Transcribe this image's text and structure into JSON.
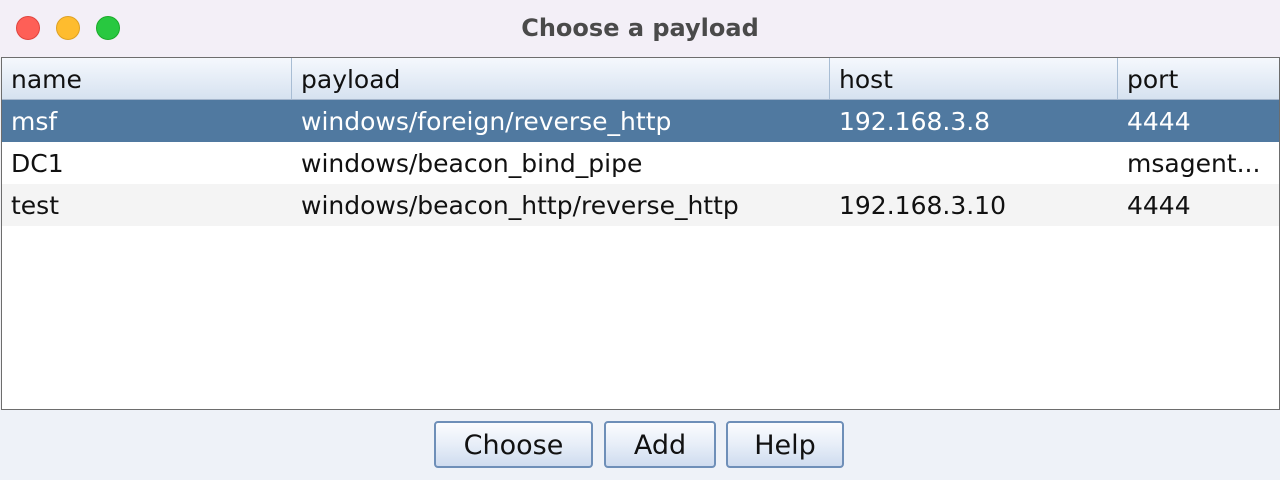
{
  "window": {
    "title": "Choose a payload"
  },
  "table": {
    "columns": [
      "name",
      "payload",
      "host",
      "port"
    ],
    "rows": [
      {
        "name": "msf",
        "payload": "windows/foreign/reverse_http",
        "host": "192.168.3.8",
        "port": "4444",
        "selected": true
      },
      {
        "name": "DC1",
        "payload": "windows/beacon_bind_pipe",
        "host": "",
        "port": "msagent...",
        "selected": false
      },
      {
        "name": "test",
        "payload": "windows/beacon_http/reverse_http",
        "host": "192.168.3.10",
        "port": "4444",
        "selected": false
      }
    ]
  },
  "buttons": {
    "choose_label": "Choose",
    "add_label": "Add",
    "help_label": "Help"
  },
  "colors": {
    "selection": "#5079a0",
    "close": "#fe5f57",
    "minimize": "#febc2e",
    "zoom": "#28c840"
  }
}
